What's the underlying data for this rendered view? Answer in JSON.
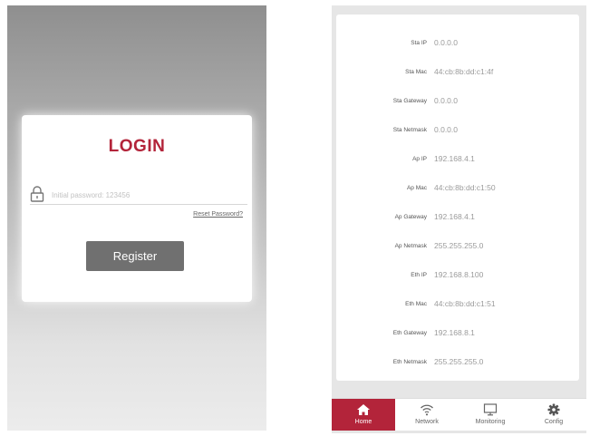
{
  "login": {
    "title": "LOGIN",
    "password_placeholder": "Initial password: 123456",
    "password_value": "",
    "reset_link": "Reset Password?",
    "register_label": "Register"
  },
  "info": {
    "rows": [
      {
        "label": "Sta IP",
        "value": "0.0.0.0"
      },
      {
        "label": "Sta Mac",
        "value": "44:cb:8b:dd:c1:4f"
      },
      {
        "label": "Sta Gateway",
        "value": "0.0.0.0"
      },
      {
        "label": "Sta Netmask",
        "value": "0.0.0.0"
      },
      {
        "label": "Ap IP",
        "value": "192.168.4.1"
      },
      {
        "label": "Ap Mac",
        "value": "44:cb:8b:dd:c1:50"
      },
      {
        "label": "Ap Gateway",
        "value": "192.168.4.1"
      },
      {
        "label": "Ap Netmask",
        "value": "255.255.255.0"
      },
      {
        "label": "Eth IP",
        "value": "192.168.8.100"
      },
      {
        "label": "Eth Mac",
        "value": "44:cb:8b:dd:c1:51"
      },
      {
        "label": "Eth Gateway",
        "value": "192.168.8.1"
      },
      {
        "label": "Eth Netmask",
        "value": "255.255.255.0"
      }
    ]
  },
  "nav": {
    "items": [
      {
        "label": "Home",
        "icon": "home-icon",
        "active": true
      },
      {
        "label": "Network",
        "icon": "wifi-icon",
        "active": false
      },
      {
        "label": "Monitoring",
        "icon": "monitor-icon",
        "active": false
      },
      {
        "label": "Config",
        "icon": "gear-icon",
        "active": false
      }
    ]
  },
  "colors": {
    "accent": "#b3243a",
    "button": "#707070"
  }
}
